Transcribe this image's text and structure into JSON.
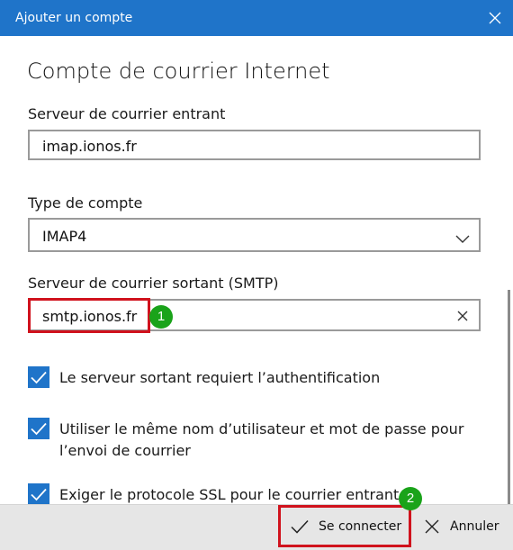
{
  "window": {
    "title": "Ajouter un compte",
    "close_icon": "close-icon"
  },
  "page": {
    "heading": "Compte de courrier Internet"
  },
  "incoming": {
    "label": "Serveur de courrier entrant",
    "value": "imap.ionos.fr"
  },
  "account_type": {
    "label": "Type de compte",
    "selected": "IMAP4"
  },
  "outgoing": {
    "label": "Serveur de courrier sortant (SMTP)",
    "value": "smtp.ionos.fr"
  },
  "options": [
    {
      "checked": true,
      "lines": [
        "Le serveur sortant requiert l’authentification"
      ]
    },
    {
      "checked": true,
      "lines": [
        "Utiliser le même nom d’utilisateur et mot de passe pour",
        "l’envoi de courrier"
      ]
    },
    {
      "checked": true,
      "lines": [
        "Exiger le protocole SSL pour le courrier entrant"
      ]
    }
  ],
  "footer": {
    "connect_label": "Se connecter",
    "cancel_label": "Annuler"
  },
  "annotations": {
    "badge1": "1",
    "badge2": "2"
  },
  "colors": {
    "accent": "#1f74c9",
    "annotation_red": "#d0121d",
    "annotation_green": "#1aa31a"
  }
}
